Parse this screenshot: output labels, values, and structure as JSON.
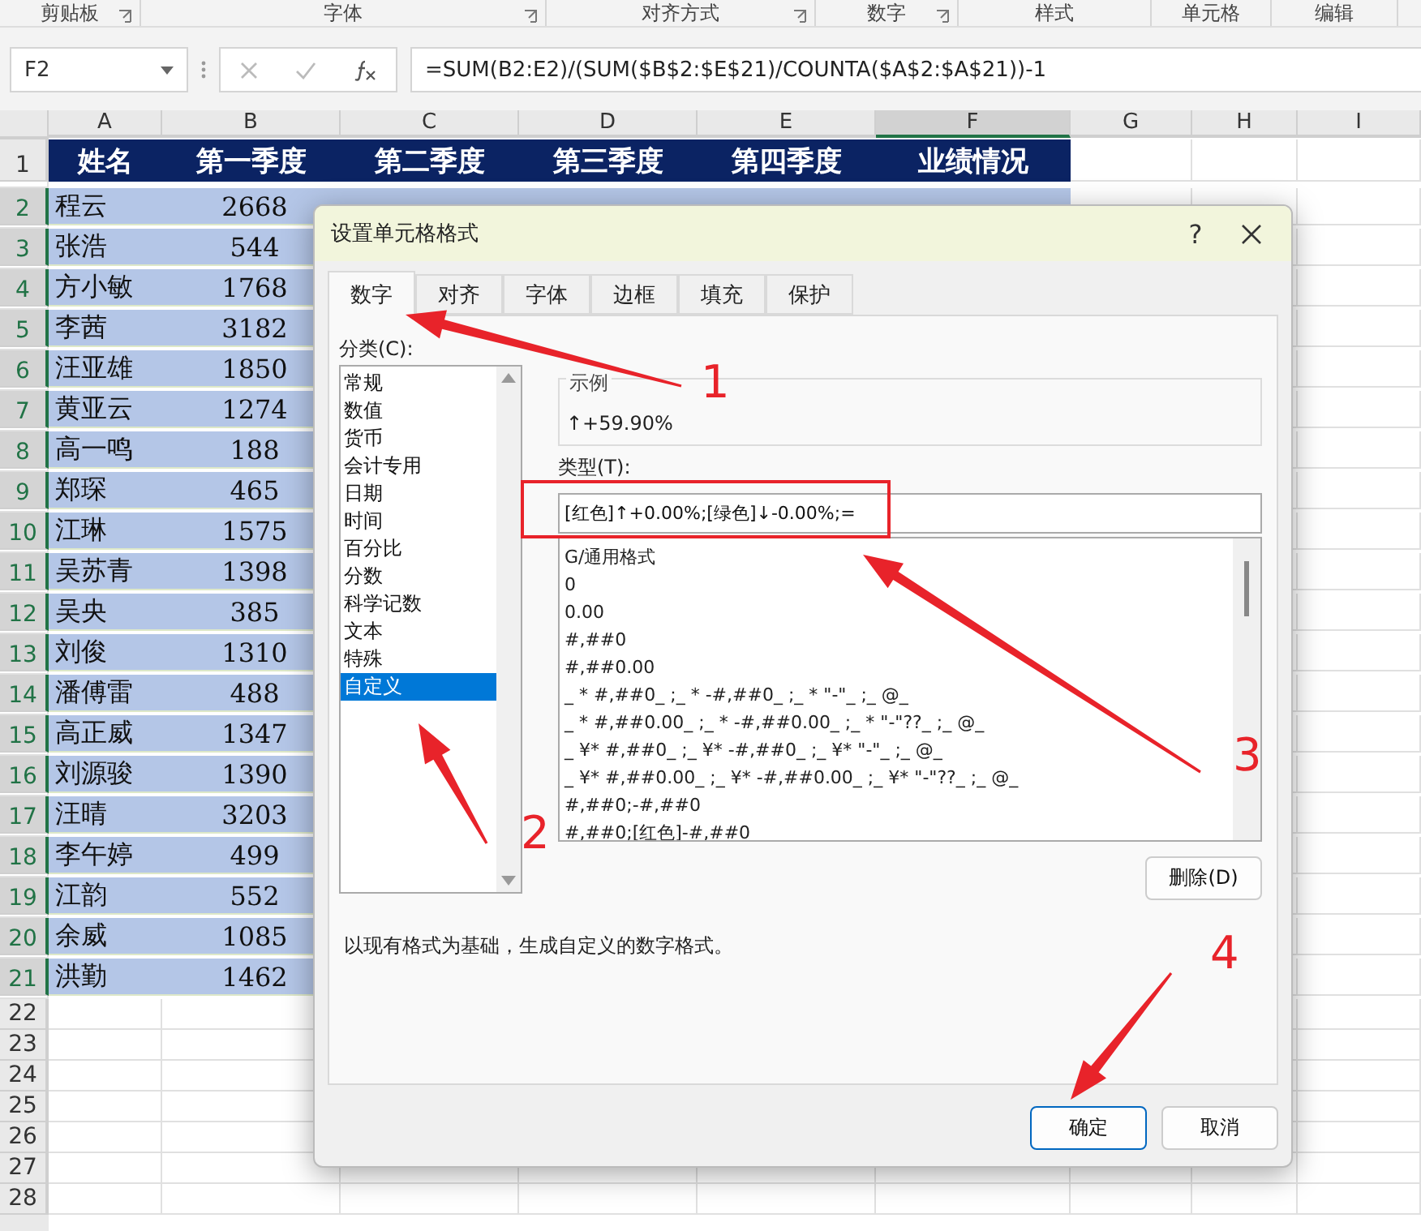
{
  "ribbon_groups": [
    {
      "label": "剪贴板",
      "launcher": true
    },
    {
      "label": "字体",
      "launcher": true
    },
    {
      "label": "对齐方式",
      "launcher": true
    },
    {
      "label": "数字",
      "launcher": true
    },
    {
      "label": "样式",
      "launcher": false
    },
    {
      "label": "单元格",
      "launcher": false
    },
    {
      "label": "编辑",
      "launcher": false
    }
  ],
  "formula_bar": {
    "name_box": "F2",
    "formula": "=SUM(B2:E2)/(SUM($B$2:$E$21)/COUNTA($A$2:$A$21))-1"
  },
  "columns": [
    {
      "label": "A",
      "selected": false
    },
    {
      "label": "B",
      "selected": false
    },
    {
      "label": "C",
      "selected": false
    },
    {
      "label": "D",
      "selected": false
    },
    {
      "label": "E",
      "selected": false
    },
    {
      "label": "F",
      "selected": true
    },
    {
      "label": "G",
      "selected": false
    },
    {
      "label": "H",
      "selected": false
    },
    {
      "label": "I",
      "selected": false
    }
  ],
  "header_row": {
    "num": "1",
    "cells": [
      "姓名",
      "第一季度",
      "第二季度",
      "第三季度",
      "第四季度",
      "业绩情况"
    ]
  },
  "rows": [
    {
      "num": "2",
      "name": "程云",
      "q1": "2668",
      "selected": true
    },
    {
      "num": "3",
      "name": "张浩",
      "q1": "544",
      "selected": true
    },
    {
      "num": "4",
      "name": "方小敏",
      "q1": "1768",
      "selected": true
    },
    {
      "num": "5",
      "name": "李茜",
      "q1": "3182",
      "selected": true
    },
    {
      "num": "6",
      "name": "汪亚雄",
      "q1": "1850",
      "selected": true
    },
    {
      "num": "7",
      "name": "黄亚云",
      "q1": "1274",
      "selected": true
    },
    {
      "num": "8",
      "name": "高一鸣",
      "q1": "188",
      "selected": true
    },
    {
      "num": "9",
      "name": "郑琛",
      "q1": "465",
      "selected": true
    },
    {
      "num": "10",
      "name": "江琳",
      "q1": "1575",
      "selected": true
    },
    {
      "num": "11",
      "name": "吴苏青",
      "q1": "1398",
      "selected": true
    },
    {
      "num": "12",
      "name": "吴央",
      "q1": "385",
      "selected": true
    },
    {
      "num": "13",
      "name": "刘俊",
      "q1": "1310",
      "selected": true
    },
    {
      "num": "14",
      "name": "潘傅雷",
      "q1": "488",
      "selected": true
    },
    {
      "num": "15",
      "name": "高正威",
      "q1": "1347",
      "selected": true
    },
    {
      "num": "16",
      "name": "刘源骏",
      "q1": "1390",
      "selected": true
    },
    {
      "num": "17",
      "name": "汪晴",
      "q1": "3203",
      "selected": true
    },
    {
      "num": "18",
      "name": "李午婷",
      "q1": "499",
      "selected": true
    },
    {
      "num": "19",
      "name": "江韵",
      "q1": "552",
      "selected": true
    },
    {
      "num": "20",
      "name": "余威",
      "q1": "1085",
      "selected": true
    },
    {
      "num": "21",
      "name": "洪勤",
      "q1": "1462",
      "selected": true
    }
  ],
  "empty_rows": [
    "22",
    "23",
    "24",
    "25",
    "26",
    "27",
    "28"
  ],
  "dialog": {
    "title": "设置单元格格式",
    "help": "?",
    "tabs": [
      {
        "label": "数字",
        "selected": true
      },
      {
        "label": "对齐",
        "selected": false
      },
      {
        "label": "字体",
        "selected": false
      },
      {
        "label": "边框",
        "selected": false
      },
      {
        "label": "填充",
        "selected": false
      },
      {
        "label": "保护",
        "selected": false
      }
    ],
    "category_label": "分类(C):",
    "categories": [
      {
        "label": "常规",
        "selected": false
      },
      {
        "label": "数值",
        "selected": false
      },
      {
        "label": "货币",
        "selected": false
      },
      {
        "label": "会计专用",
        "selected": false
      },
      {
        "label": "日期",
        "selected": false
      },
      {
        "label": "时间",
        "selected": false
      },
      {
        "label": "百分比",
        "selected": false
      },
      {
        "label": "分数",
        "selected": false
      },
      {
        "label": "科学记数",
        "selected": false
      },
      {
        "label": "文本",
        "selected": false
      },
      {
        "label": "特殊",
        "selected": false
      },
      {
        "label": "自定义",
        "selected": true
      }
    ],
    "sample_label": "示例",
    "sample_value": "↑+59.90%",
    "type_label": "类型(T):",
    "type_value": "[红色]↑+0.00%;[绿色]↓-0.00%;=",
    "formats": [
      "G/通用格式",
      "0",
      "0.00",
      "#,##0",
      "#,##0.00",
      "_ * #,##0_ ;_ * -#,##0_ ;_ * \"-\"_ ;_ @_",
      "_ * #,##0.00_ ;_ * -#,##0.00_ ;_ * \"-\"??_ ;_ @_",
      "_ ¥* #,##0_ ;_ ¥* -#,##0_ ;_ ¥* \"-\"_ ;_ @_",
      "_ ¥* #,##0.00_ ;_ ¥* -#,##0.00_ ;_ ¥* \"-\"??_ ;_ @_",
      "#,##0;-#,##0",
      "#,##0;[红色]-#,##0"
    ],
    "delete_button": "删除(D)",
    "description": "以现有格式为基础，生成自定义的数字格式。",
    "buttons": [
      {
        "label": "确定",
        "default": true
      },
      {
        "label": "取消",
        "default": false
      }
    ]
  },
  "annotations": [
    {
      "label": "1"
    },
    {
      "label": "2"
    },
    {
      "label": "3"
    },
    {
      "label": "4"
    }
  ]
}
